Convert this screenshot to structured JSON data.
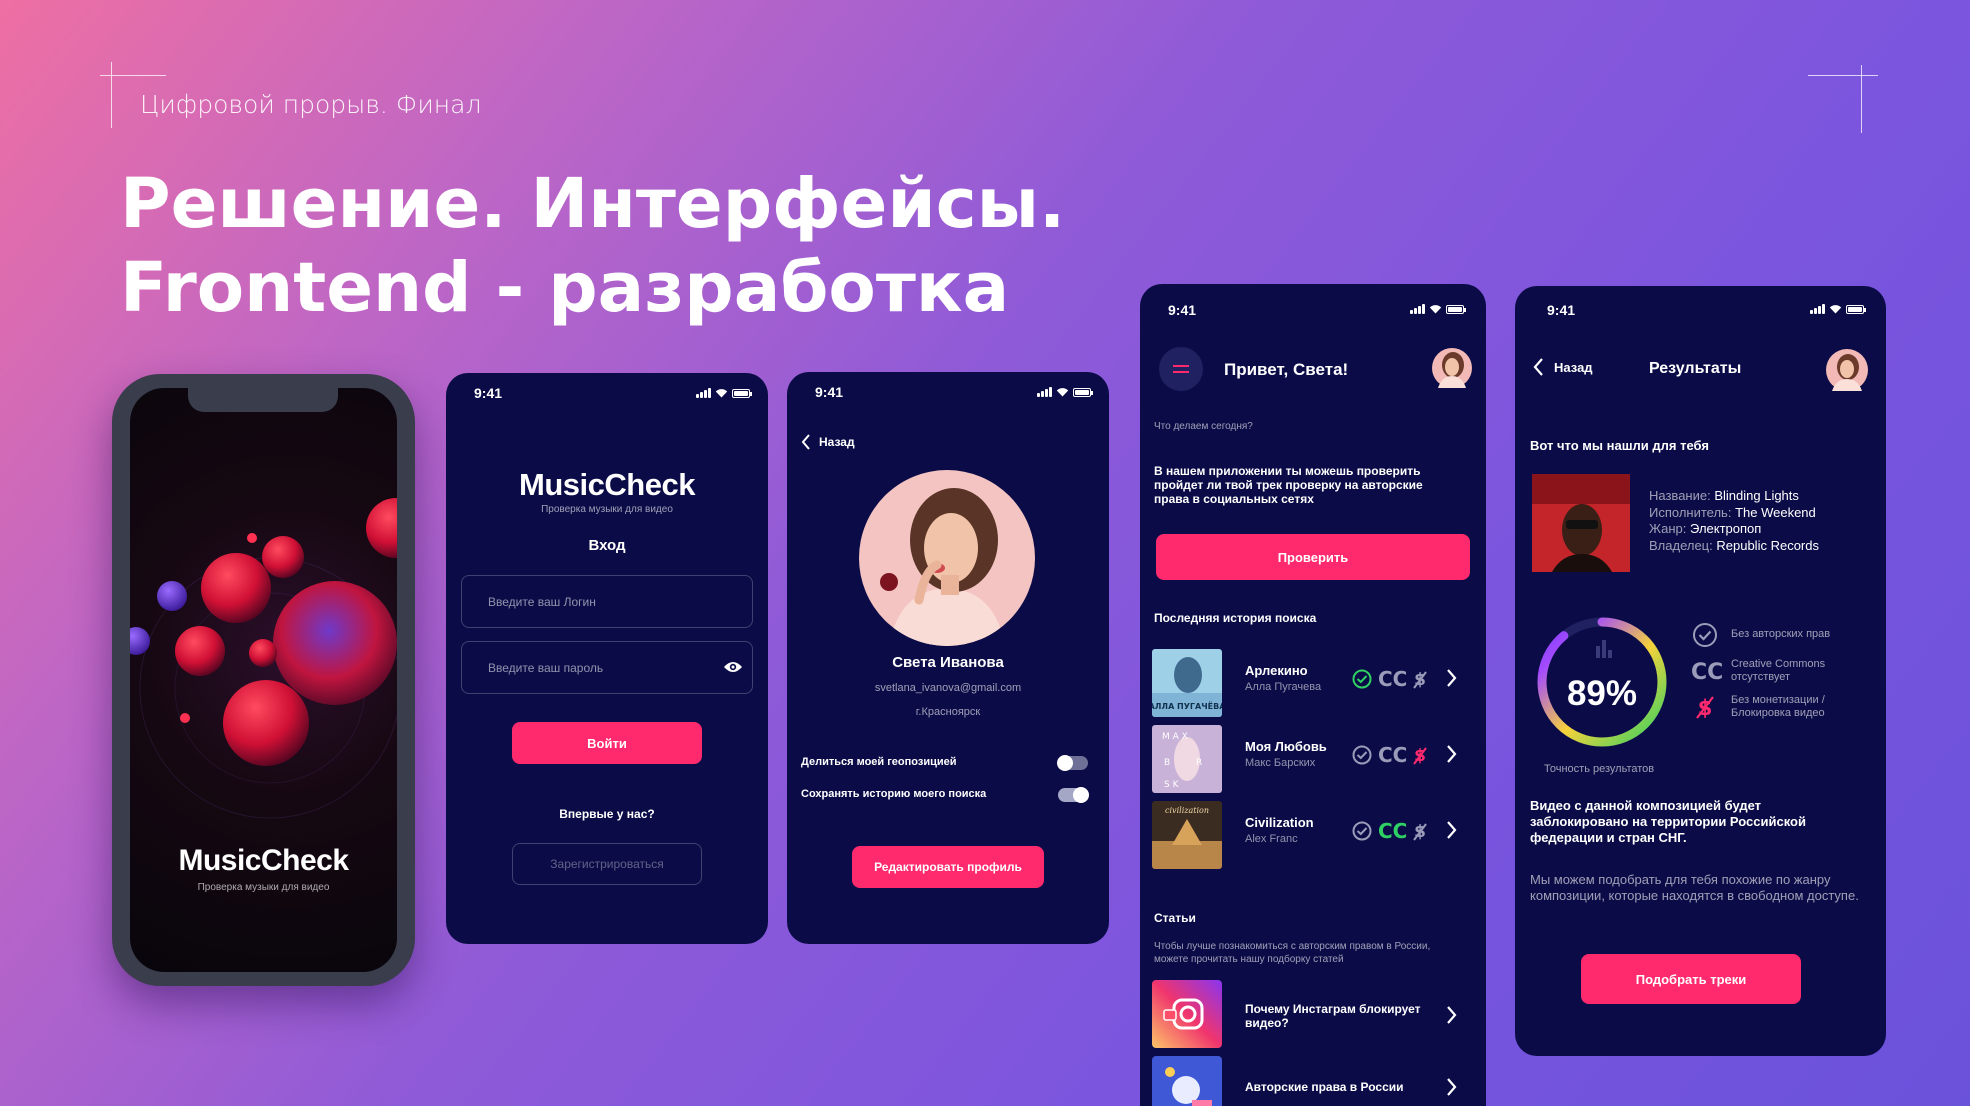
{
  "slide": {
    "subtitle": "Цифровой прорыв. Финал",
    "title": "Решение. Интерфейсы. Frontend - разработка"
  },
  "splash": {
    "brand": "MusicCheck",
    "tagline": "Проверка музыки для видео"
  },
  "status": {
    "time": "9:41"
  },
  "login": {
    "brand": "MusicCheck",
    "tagline": "Проверка музыки для видео",
    "heading": "Вход",
    "login_placeholder": "Введите ваш Логин",
    "password_placeholder": "Введите ваш пароль",
    "submit_label": "Войти",
    "first_time": "Впервые у нас?",
    "register_label": "Зарегистрироваться"
  },
  "profile": {
    "back_label": "Назад",
    "name": "Света Иванова",
    "email": "svetlana_ivanova@gmail.com",
    "city": "г.Красноярск",
    "geo_label": "Делиться моей геопозицией",
    "history_label": "Сохранять историю моего поиска",
    "geo_enabled": false,
    "history_enabled": true,
    "edit_label": "Редактировать профиль"
  },
  "home": {
    "greeting": "Привет, Света!",
    "question": "Что делаем сегодня?",
    "intro": "В нашем приложении ты можешь проверить пройдет ли твой трек проверку на авторские права в социальных сетях",
    "check_label": "Проверить",
    "history_title": "Последняя история поиска",
    "history": [
      {
        "title": "Арлекино",
        "artist": "Алла Пугачева",
        "cover_text": "АЛЛА ПУГАЧЁВА"
      },
      {
        "title": "Моя Любовь",
        "artist": "Макс Барских",
        "cover_text": "M A X B A R S K I"
      },
      {
        "title": "Civilization",
        "artist": "Alex Franc",
        "cover_text": "civilization"
      }
    ],
    "articles_title": "Статьи",
    "articles_intro": "Чтобы лучше познакомиться с авторским правом в России, можете прочитать нашу подборку статей",
    "articles": [
      {
        "title": "Почему Инстаграм блокирует видео?"
      },
      {
        "title": "Авторские права в России"
      }
    ],
    "badge_text": "CC"
  },
  "results": {
    "back_label": "Назад",
    "title": "Результаты",
    "found_heading": "Вот что мы нашли для тебя",
    "name_label": "Название:",
    "name_value": "Blinding Lights",
    "artist_label": "Исполнитель:",
    "artist_value": "The Weekend",
    "genre_label": "Жанр:",
    "genre_value": "Электропоп",
    "owner_label": "Владелец:",
    "owner_value": "Republic Records",
    "accuracy": "89%",
    "accuracy_value": 0.89,
    "accuracy_label": "Точность результатов",
    "legend_cc": "CC",
    "legend": [
      "Без авторских прав",
      "Creative Commons отсутствует",
      "Без монетизации / Блокировка видео"
    ],
    "warning": "Видео с данной композицией будет заблокировано на территории Российской федерации и стран СНГ.",
    "suggestion": "Мы можем подобрать для тебя похожие по жанру композиции, которые находятся в свободном доступе.",
    "pick_label": "Подобрать треки"
  }
}
